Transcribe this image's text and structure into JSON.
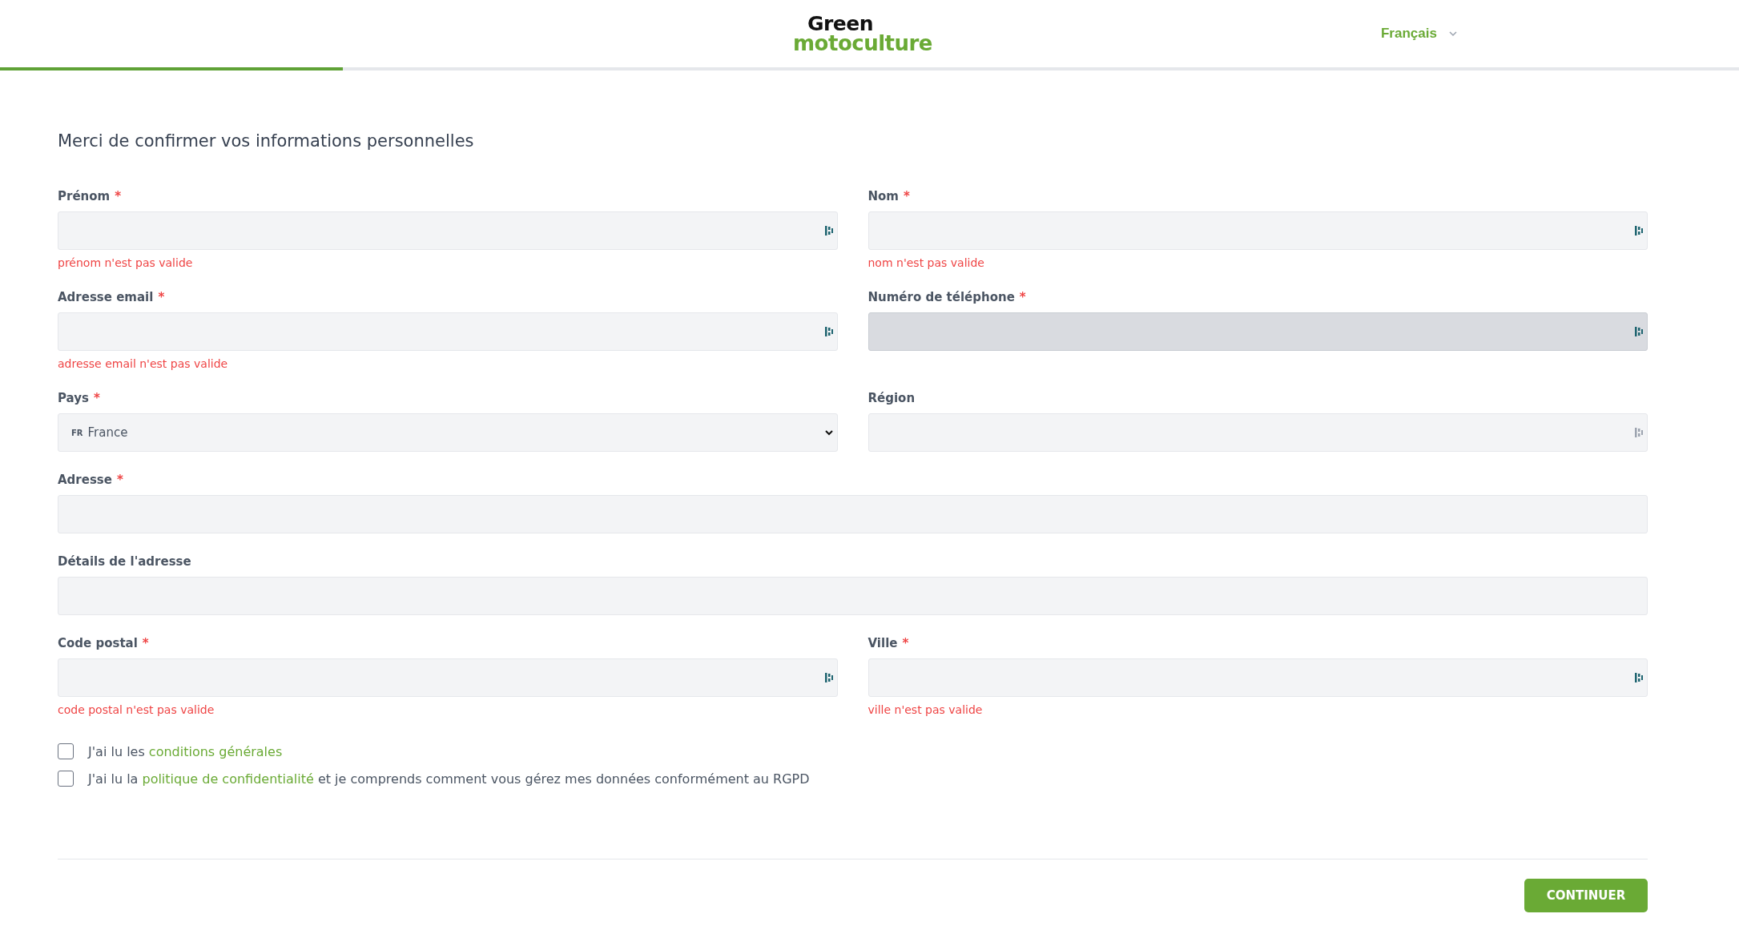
{
  "header": {
    "logo_top": "Green",
    "logo_bottom": "motoculture",
    "language": "Français"
  },
  "progress": {
    "level": 0.197
  },
  "title": "Merci de confirmer vos informations personnelles",
  "rows": [
    {
      "fields": [
        {
          "label": "Prénom",
          "required": "*",
          "kind": "text",
          "autofill_icon": true,
          "disabled": false,
          "error": "prénom n'est pas valide"
        },
        {
          "label": "Nom",
          "required": "*",
          "kind": "text",
          "autofill_icon": true,
          "disabled": false,
          "error": "nom n'est pas valide"
        }
      ]
    },
    {
      "fields": [
        {
          "label": "Adresse email",
          "required": "*",
          "kind": "text",
          "autofill_icon": true,
          "disabled": false,
          "error": "adresse email n'est pas valide"
        },
        {
          "label": "Numéro de téléphone",
          "required": "*",
          "kind": "text",
          "autofill_icon": true,
          "disabled": true
        }
      ]
    },
    {
      "fields": [
        {
          "label": "Pays",
          "required": "*",
          "kind": "select",
          "flag": "FR",
          "value": "France"
        },
        {
          "label": "Région",
          "kind": "text",
          "autofill_icon": true,
          "disabled": false
        }
      ]
    },
    {
      "fields": [
        {
          "label": "Adresse",
          "required": "*",
          "kind": "text",
          "autofill_icon": false,
          "disabled": false
        }
      ]
    },
    {
      "fields": [
        {
          "label": "Détails de l'adresse",
          "kind": "text",
          "autofill_icon": false,
          "disabled": false
        }
      ]
    },
    {
      "fields": [
        {
          "label": "Code postal",
          "required": "*",
          "kind": "text",
          "autofill_icon": true,
          "disabled": false,
          "error": "code postal n'est pas valide"
        },
        {
          "label": "Ville",
          "required": "*",
          "kind": "text",
          "autofill_icon": true,
          "disabled": false,
          "error": "ville n'est pas valide"
        }
      ]
    }
  ],
  "consents": [
    {
      "checked": false,
      "before": "J'ai lu les",
      "link": "conditions générales"
    },
    {
      "checked": false,
      "before": "J'ai lu la",
      "link": "politique de confidentialité",
      "after": "et je comprends comment vous gérez mes données conformément au RGPD"
    }
  ],
  "button": "CONTINUER"
}
